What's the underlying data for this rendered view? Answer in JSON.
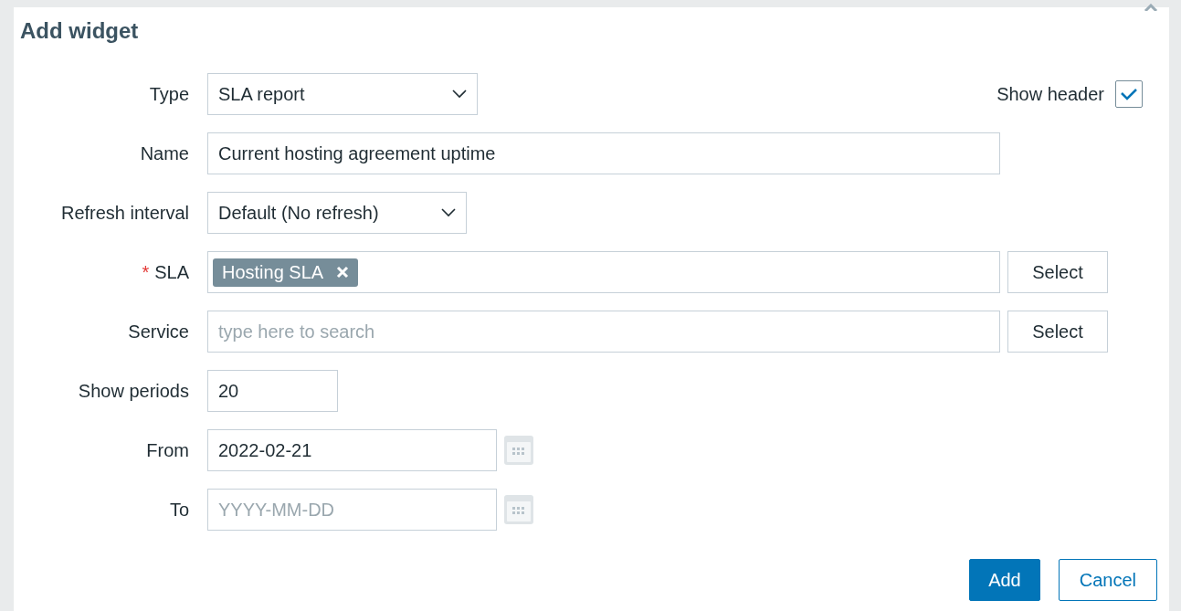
{
  "dialog": {
    "title": "Add widget"
  },
  "show_header": {
    "label": "Show header",
    "checked": true
  },
  "fields": [
    {
      "kind": "select",
      "label": "Type",
      "value": "SLA report"
    },
    {
      "kind": "text",
      "label": "Name",
      "value": "Current hosting agreement uptime"
    },
    {
      "kind": "select",
      "label": "Refresh interval",
      "value": "Default (No refresh)"
    },
    {
      "kind": "multiselect",
      "label": "SLA",
      "required_mark": "*",
      "tags": [
        "Hosting SLA"
      ],
      "button": "Select"
    },
    {
      "kind": "multiselect",
      "label": "Service",
      "placeholder": "type here to search",
      "button": "Select"
    },
    {
      "kind": "text",
      "label": "Show periods",
      "value": "20"
    },
    {
      "kind": "date",
      "label": "From",
      "value": "2022-02-21"
    },
    {
      "kind": "date",
      "label": "To",
      "placeholder": "YYYY-MM-DD"
    }
  ],
  "buttons": [
    {
      "label": "Add",
      "primary": true
    },
    {
      "label": "Cancel",
      "primary": false
    }
  ]
}
